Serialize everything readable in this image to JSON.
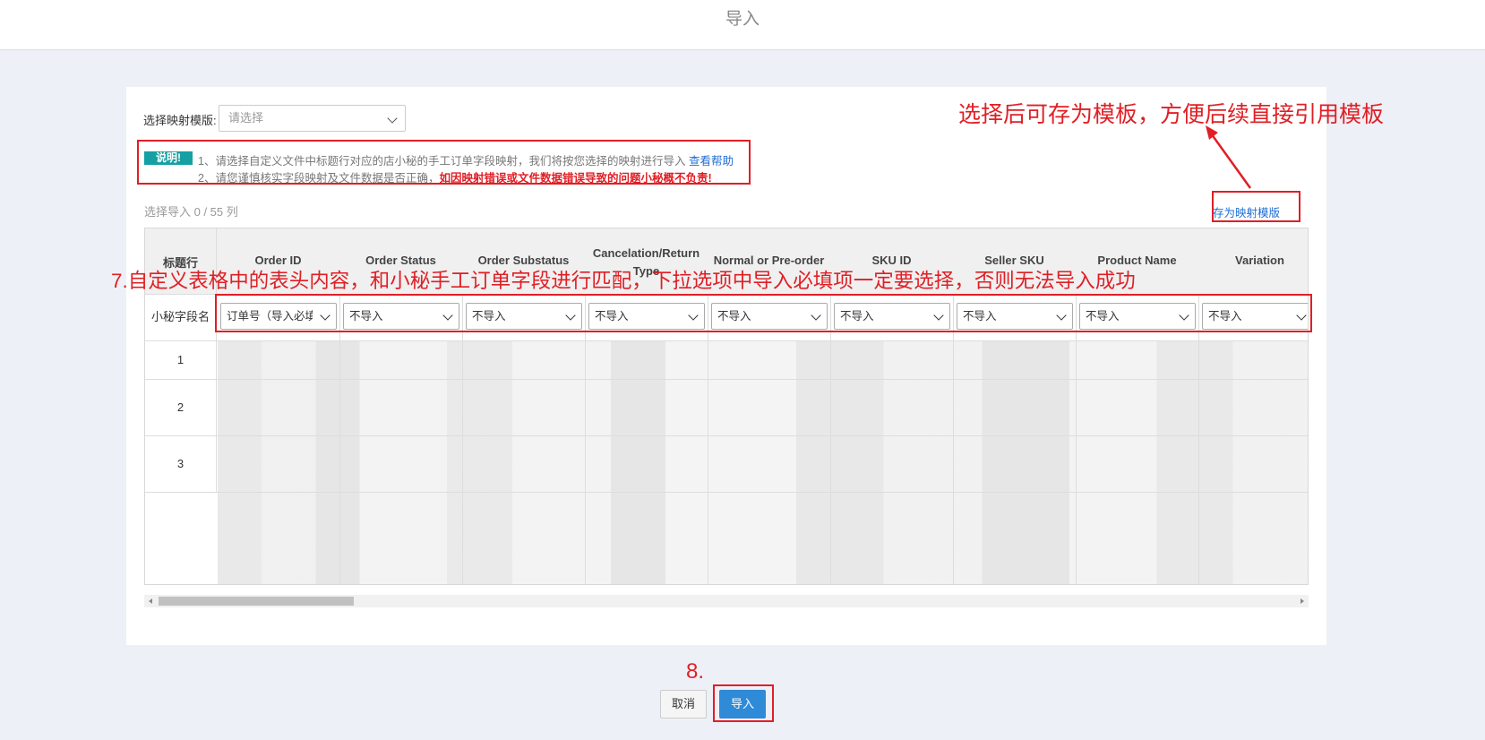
{
  "header": {
    "title": "导入"
  },
  "template": {
    "label": "选择映射模版:",
    "placeholder": "请选择"
  },
  "note": {
    "badge": "说明!",
    "line1": "1、请选择自定义文件中标题行对应的店小秘的手工订单字段映射，我们将按您选择的映射进行导入",
    "help_link": "查看帮助",
    "line2_prefix": "2、请您谨慎核实字段映射及文件数据是否正确，",
    "line2_warning": "如因映射错误或文件数据错误导致的问题小秘概不负责!"
  },
  "count": "选择导入 0  / 55 列",
  "save_template": "存为映射模版",
  "table": {
    "title_row_label": "标题行",
    "field_row_label": "小秘字段名",
    "columns": [
      "Order ID",
      "Order Status",
      "Order Substatus",
      "Cancelation/Return Type",
      "Normal or Pre-order",
      "SKU ID",
      "Seller SKU",
      "Product Name",
      "Variation"
    ],
    "mappings": [
      "订单号（导入必填）",
      "不导入",
      "不导入",
      "不导入",
      "不导入",
      "不导入",
      "不导入",
      "不导入",
      "不导入"
    ],
    "row_numbers": [
      "1",
      "2",
      "3"
    ]
  },
  "annotations": {
    "template_hint": "选择后可存为模板，方便后续直接引用模板",
    "step7": "7.自定义表格中的表头内容，和小秘手工订单字段进行匹配，下拉选项中导入必填项一定要选择，否则无法导入成功",
    "step8": "8."
  },
  "buttons": {
    "cancel": "取消",
    "import": "导入"
  },
  "colors": {
    "accent": "#2f8ad8",
    "annotation": "#e01f25",
    "badge": "#16a0a3"
  }
}
